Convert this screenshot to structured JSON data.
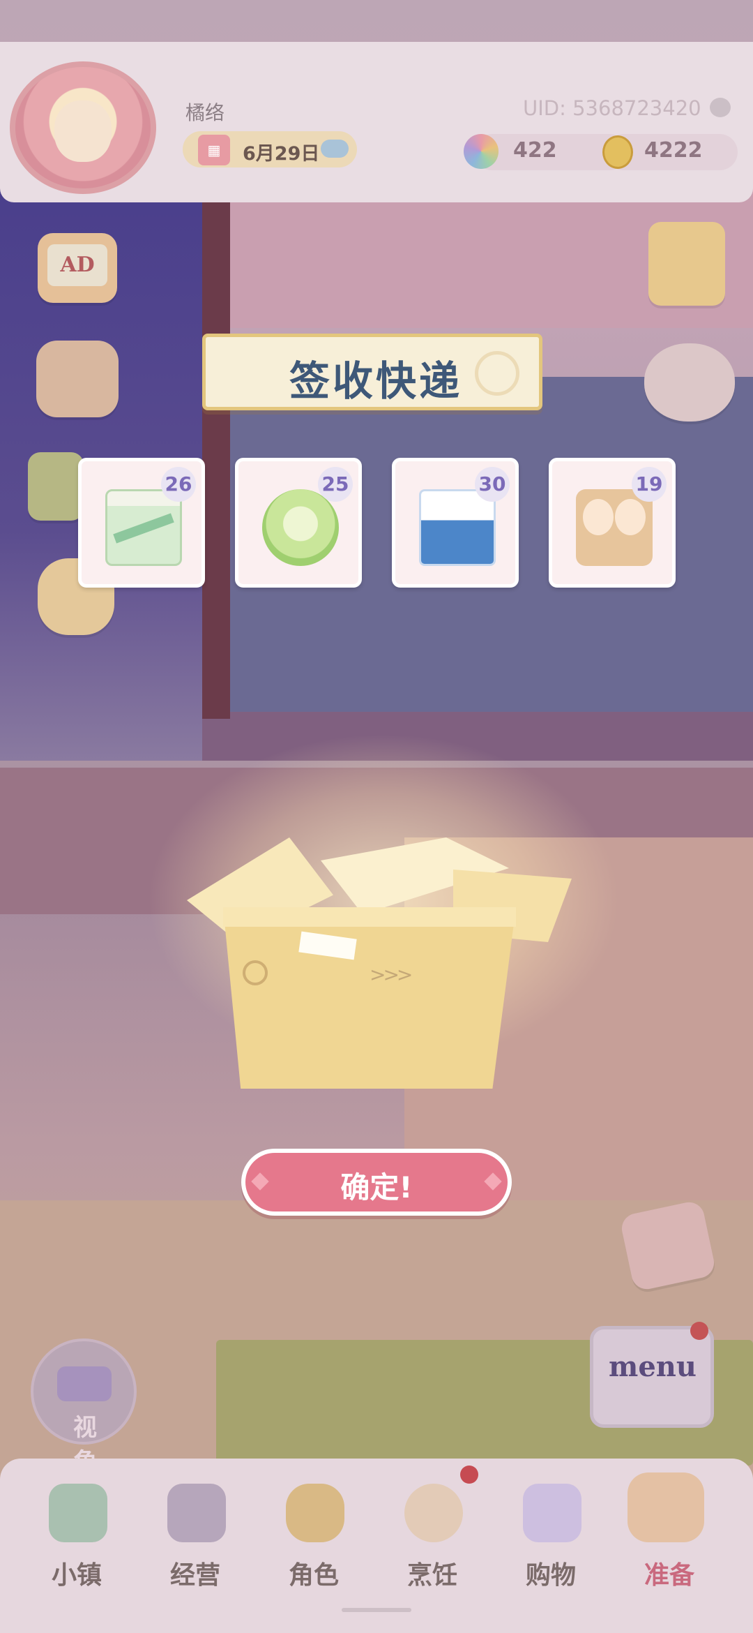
{
  "header": {
    "username": "橘络",
    "date": "6月29日",
    "uid": "UID: 5368723420",
    "gems": "422",
    "coins": "4222"
  },
  "side_buttons": {
    "ad_label": "AD",
    "camera_label": "视角",
    "menu_label": "menu"
  },
  "modal": {
    "title": "签收快递",
    "items": [
      {
        "name": "flour",
        "count": "26"
      },
      {
        "name": "cabbage",
        "count": "25"
      },
      {
        "name": "milk",
        "count": "30"
      },
      {
        "name": "eggs",
        "count": "19"
      }
    ],
    "confirm_label": "确定!"
  },
  "bottom_nav": {
    "items": [
      {
        "label": "小镇",
        "icon": "map-icon"
      },
      {
        "label": "经营",
        "icon": "shop-locked-icon"
      },
      {
        "label": "角色",
        "icon": "character-icon"
      },
      {
        "label": "烹饪",
        "icon": "cooking-icon"
      },
      {
        "label": "购物",
        "icon": "shopping-bag-icon"
      },
      {
        "label": "准备",
        "icon": "basket-icon"
      }
    ],
    "active": "准备"
  },
  "colors": {
    "accent": "#e5788c",
    "title_text": "#3e5878",
    "badge_text": "#7b6ab8"
  }
}
